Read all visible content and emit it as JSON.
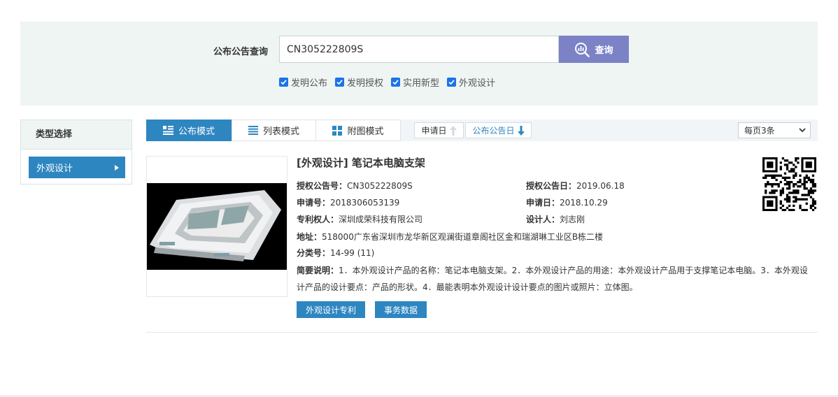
{
  "search": {
    "label": "公布公告查询",
    "value": "CN305222809S",
    "button_label": "查询",
    "filters": [
      {
        "label": "发明公布",
        "checked": true
      },
      {
        "label": "发明授权",
        "checked": true
      },
      {
        "label": "实用新型",
        "checked": true
      },
      {
        "label": "外观设计",
        "checked": true
      }
    ]
  },
  "sidebar": {
    "title": "类型选择",
    "items": [
      {
        "label": "外观设计"
      }
    ]
  },
  "toolbar": {
    "modes": [
      {
        "label": "公布模式",
        "icon": "list-detail-icon",
        "active": true
      },
      {
        "label": "列表模式",
        "icon": "list-icon",
        "active": false
      },
      {
        "label": "附图模式",
        "icon": "grid-icon",
        "active": false
      }
    ],
    "sort": [
      {
        "label": "申请日",
        "direction": "up",
        "active": false
      },
      {
        "label": "公布公告日",
        "direction": "down",
        "active": true
      }
    ],
    "per_page": "每页3条"
  },
  "result": {
    "title": "[外观设计] 笔记本电脑支架",
    "grant_no_label": "授权公告号：",
    "grant_no": "CN305222809S",
    "grant_date_label": "授权公告日：",
    "grant_date": "2019.06.18",
    "app_no_label": "申请号：",
    "app_no": "2018306053139",
    "app_date_label": "申请日：",
    "app_date": "2018.10.29",
    "patentee_label": "专利权人：",
    "patentee": "深圳成荣科技有限公司",
    "designer_label": "设计人：",
    "designer": "刘志刚",
    "address_label": "地址：",
    "address": "518000广东省深圳市龙华新区观澜街道章阁社区金和瑞湖琳工业区B栋二楼",
    "class_label": "分类号：",
    "class": "14-99 (11)",
    "abstract_label": "简要说明：",
    "abstract": "1．本外观设计产品的名称：笔记本电脑支架。2．本外观设计产品的用途：本外观设计产品用于支撑笔记本电脑。3．本外观设计产品的设计要点：产品的形状。4．最能表明本外观设计设计要点的图片或照片：立体图。",
    "buttons": [
      "外观设计专利",
      "事务数据"
    ]
  },
  "colors": {
    "accent": "#2e86c1",
    "search_button": "#7c82c6",
    "panel_bg": "#eef5f3"
  }
}
